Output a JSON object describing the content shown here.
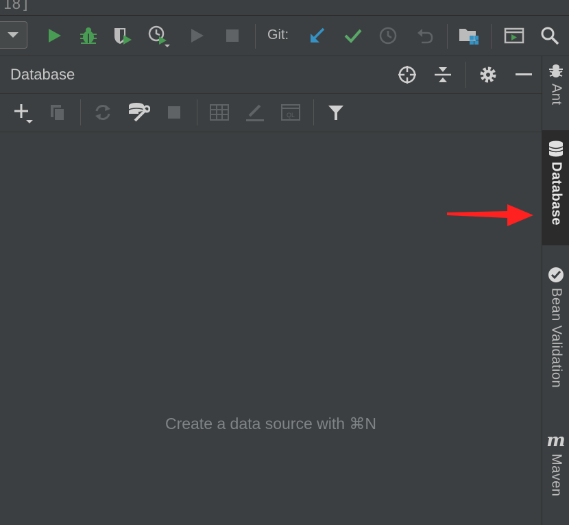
{
  "title_fragment": "18]",
  "toolbar": {
    "git_label": "Git:",
    "icons": [
      "run-icon",
      "debug-icon",
      "coverage-icon",
      "profile-icon",
      "resume-icon",
      "stop-icon",
      "git-update-icon",
      "git-commit-icon",
      "git-history-icon",
      "git-rollback-icon",
      "project-structure-icon",
      "run-panel-icon",
      "search-icon"
    ]
  },
  "panel": {
    "title": "Database",
    "header_icons": [
      "locate-icon",
      "collapse-all-icon",
      "gear-icon",
      "minimize-icon"
    ],
    "toolbar_icons": [
      "add-icon",
      "duplicate-icon",
      "refresh-icon",
      "data-source-properties-icon",
      "stop-icon",
      "table-view-icon",
      "edit-icon",
      "query-console-icon",
      "filter-icon"
    ],
    "empty_message": "Create a data source with ⌘N"
  },
  "right_stripe": {
    "items": [
      {
        "label": "Ant",
        "icon": "ant-icon",
        "active": false
      },
      {
        "label": "Database",
        "icon": "database-icon",
        "active": true
      },
      {
        "label": "Bean Validation",
        "icon": "bean-validation-icon",
        "active": false
      },
      {
        "label": "Maven",
        "icon": "maven-icon",
        "active": false,
        "glyph": "m"
      }
    ]
  },
  "colors": {
    "background": "#3c3f41",
    "run_green": "#499c54",
    "commit_green": "#59a869",
    "update_blue": "#3592c4",
    "annotation_red": "#ff2020"
  }
}
